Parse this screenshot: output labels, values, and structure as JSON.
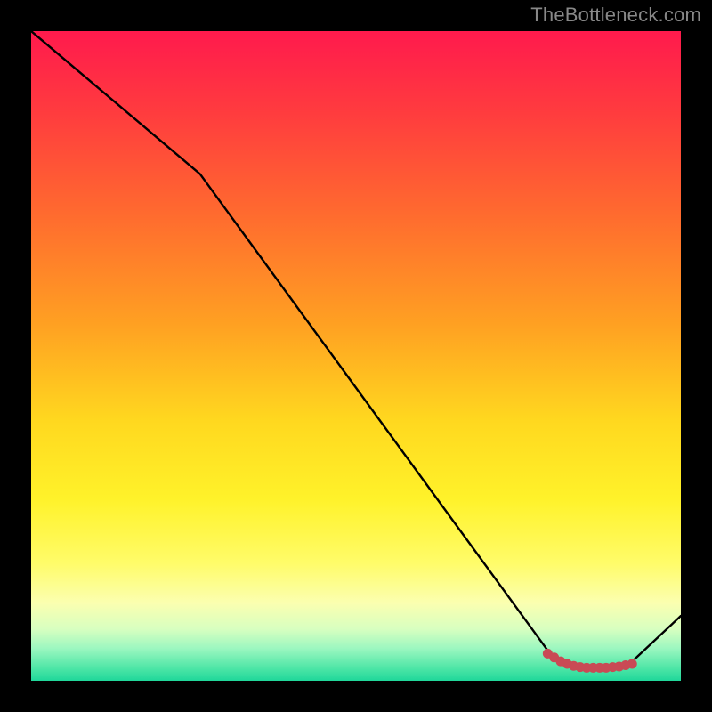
{
  "attribution": "TheBottleneck.com",
  "chart_data": {
    "type": "line",
    "title": "",
    "xlabel": "",
    "ylabel": "",
    "xlim": [
      0,
      100
    ],
    "ylim": [
      0,
      100
    ],
    "series": [
      {
        "name": "bottleneck-curve",
        "color": "#000000",
        "x": [
          0,
          26,
          80,
          82,
          86,
          92,
          100
        ],
        "values": [
          100,
          78,
          4,
          2.5,
          2,
          2.5,
          10
        ]
      }
    ],
    "markers": {
      "name": "selection-band",
      "color": "#c94a55",
      "points": [
        {
          "x": 79.5,
          "y": 4.2
        },
        {
          "x": 80.5,
          "y": 3.6
        },
        {
          "x": 81.5,
          "y": 3.0
        },
        {
          "x": 82.5,
          "y": 2.6
        },
        {
          "x": 83.5,
          "y": 2.3
        },
        {
          "x": 84.5,
          "y": 2.1
        },
        {
          "x": 85.5,
          "y": 2.0
        },
        {
          "x": 86.5,
          "y": 2.0
        },
        {
          "x": 87.5,
          "y": 2.0
        },
        {
          "x": 88.5,
          "y": 2.0
        },
        {
          "x": 89.5,
          "y": 2.1
        },
        {
          "x": 90.5,
          "y": 2.2
        },
        {
          "x": 91.5,
          "y": 2.4
        },
        {
          "x": 92.5,
          "y": 2.6
        }
      ]
    },
    "gradient_stops": [
      {
        "pos": 0,
        "color": "#ff1a4d"
      },
      {
        "pos": 12,
        "color": "#ff3a3f"
      },
      {
        "pos": 28,
        "color": "#ff6a2f"
      },
      {
        "pos": 45,
        "color": "#ffa022"
      },
      {
        "pos": 60,
        "color": "#ffd81f"
      },
      {
        "pos": 72,
        "color": "#fff22a"
      },
      {
        "pos": 82,
        "color": "#fffc6a"
      },
      {
        "pos": 88,
        "color": "#fbffb0"
      },
      {
        "pos": 92,
        "color": "#d8ffc0"
      },
      {
        "pos": 95,
        "color": "#9cf7c0"
      },
      {
        "pos": 98,
        "color": "#4fe6a7"
      },
      {
        "pos": 100,
        "color": "#1fd79a"
      }
    ]
  }
}
